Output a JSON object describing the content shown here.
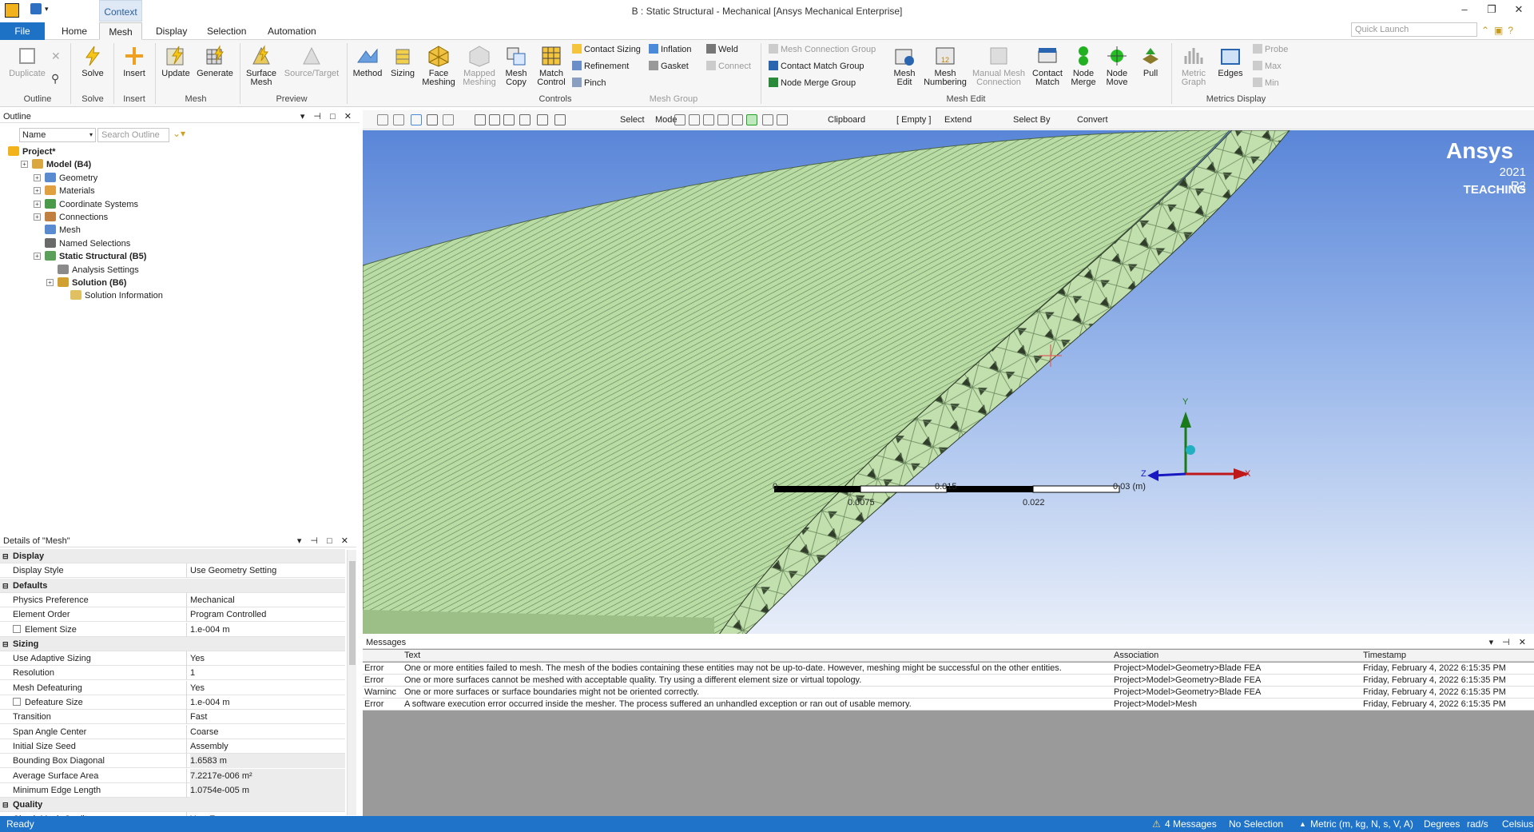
{
  "window": {
    "title": "B : Static Structural - Mechanical [Ansys Mechanical Enterprise]",
    "minimize": "–",
    "restore": "❐",
    "close": "✕",
    "quick_launch_placeholder": "Quick Launch"
  },
  "context_tab": "Context",
  "tabs": [
    "File",
    "Home",
    "Mesh",
    "Display",
    "Selection",
    "Automation"
  ],
  "active_tab": "Mesh",
  "ribbon": {
    "duplicate": "Duplicate",
    "solve": "Solve",
    "insert": "Insert",
    "update": "Update",
    "generate": "Generate",
    "surface_mesh": "Surface Mesh",
    "source_target": "Source/Target",
    "method": "Method",
    "sizing": "Sizing",
    "face_meshing": "Face Meshing",
    "mapped_meshing": "Mapped Meshing",
    "mesh_copy": "Mesh Copy",
    "match_control": "Match Control",
    "contact_sizing": "Contact Sizing",
    "refinement": "Refinement",
    "pinch": "Pinch",
    "inflation": "Inflation",
    "gasket": "Gasket",
    "weld": "Weld",
    "connect": "Connect",
    "mesh_connection_group": "Mesh Connection Group",
    "contact_match_group": "Contact Match Group",
    "node_merge_group": "Node Merge Group",
    "mesh_edit": "Mesh Edit",
    "mesh_numbering": "Mesh Numbering",
    "manual_mesh_connection": "Manual Mesh Connection",
    "contact_match": "Contact Match",
    "node_merge": "Node Merge",
    "node_move": "Node Move",
    "pull": "Pull",
    "metric_graph": "Metric Graph",
    "edges": "Edges",
    "probe": "Probe",
    "max": "Max",
    "min": "Min",
    "groups": {
      "outline": "Outline",
      "solve": "Solve",
      "insert": "Insert",
      "mesh": "Mesh",
      "preview": "Preview",
      "controls": "Controls",
      "mesh_group": "Mesh Group",
      "mesh_edit": "Mesh Edit",
      "metrics_display": "Metrics Display"
    }
  },
  "outline": {
    "title": "Outline",
    "name_filter": "Name",
    "search_placeholder": "Search Outline",
    "tree": [
      {
        "label": "Project*",
        "bold": true
      },
      {
        "label": "Model (B4)",
        "bold": true
      },
      {
        "label": "Geometry",
        "bold": false
      },
      {
        "label": "Materials",
        "bold": false
      },
      {
        "label": "Coordinate Systems",
        "bold": false
      },
      {
        "label": "Connections",
        "bold": false
      },
      {
        "label": "Mesh",
        "bold": false
      },
      {
        "label": "Named Selections",
        "bold": false
      },
      {
        "label": "Static Structural (B5)",
        "bold": true
      },
      {
        "label": "Analysis Settings",
        "bold": false
      },
      {
        "label": "Solution (B6)",
        "bold": true
      },
      {
        "label": "Solution Information",
        "bold": false
      }
    ]
  },
  "details": {
    "title": "Details of \"Mesh\"",
    "rows": [
      {
        "type": "section",
        "k": "Display"
      },
      {
        "k": "Display Style",
        "v": "Use Geometry Setting"
      },
      {
        "type": "section",
        "k": "Defaults"
      },
      {
        "k": "Physics Preference",
        "v": "Mechanical"
      },
      {
        "k": "Element Order",
        "v": "Program Controlled"
      },
      {
        "k": "Element Size",
        "v": "1.e-004 m",
        "check": true
      },
      {
        "type": "section",
        "k": "Sizing"
      },
      {
        "k": "Use Adaptive Sizing",
        "v": "Yes"
      },
      {
        "k": "Resolution",
        "v": "1"
      },
      {
        "k": "Mesh Defeaturing",
        "v": "Yes"
      },
      {
        "k": "Defeature Size",
        "v": "1.e-004 m",
        "check": true
      },
      {
        "k": "Transition",
        "v": "Fast"
      },
      {
        "k": "Span Angle Center",
        "v": "Coarse"
      },
      {
        "k": "Initial Size Seed",
        "v": "Assembly"
      },
      {
        "k": "Bounding Box Diagonal",
        "v": "1.6583 m",
        "ro": true
      },
      {
        "k": "Average Surface Area",
        "v": "7.2217e-006 m²",
        "ro": true
      },
      {
        "k": "Minimum Edge Length",
        "v": "1.0754e-005 m",
        "ro": true
      },
      {
        "type": "section",
        "k": "Quality"
      },
      {
        "k": "Check Mesh Quality",
        "v": "Yes, Errors"
      }
    ]
  },
  "graphics_toolbar": {
    "select": "Select",
    "mode": "Mode",
    "clipboard": "Clipboard",
    "empty": "[ Empty ]",
    "extend": "Extend",
    "select_by": "Select By",
    "convert": "Convert"
  },
  "viewport": {
    "brand": "Ansys",
    "version": "2021 R2",
    "edition": "TEACHING",
    "scale_labels_top": [
      "0",
      "0.015",
      "0.03 (m)"
    ],
    "scale_labels_bottom": [
      "0.0075",
      "0.022"
    ],
    "axes": {
      "x": "X",
      "y": "Y",
      "z": "Z"
    }
  },
  "messages": {
    "title": "Messages",
    "columns": [
      "Text",
      "Association",
      "Timestamp"
    ],
    "rows": [
      {
        "type": "Error",
        "text": "One or more entities failed to mesh. The mesh of the bodies containing these entities may not be up-to-date.  However, meshing might be successful on the other entities.",
        "assoc": "Project>Model>Geometry>Blade FEA",
        "time": "Friday, February 4, 2022 6:15:35 PM"
      },
      {
        "type": "Error",
        "text": "One or more surfaces cannot be meshed with acceptable quality. Try using a different element size or virtual topology.",
        "assoc": "Project>Model>Geometry>Blade FEA",
        "time": "Friday, February 4, 2022 6:15:35 PM"
      },
      {
        "type": "Warninc",
        "text": "One or more surfaces or surface boundaries might not be oriented correctly.",
        "assoc": "Project>Model>Geometry>Blade FEA",
        "time": "Friday, February 4, 2022 6:15:35 PM"
      },
      {
        "type": "Error",
        "text": "A software execution error occurred inside the mesher.  The process suffered an unhandled exception or ran out of usable memory.",
        "assoc": "Project>Model>Mesh",
        "time": "Friday, February 4, 2022 6:15:35 PM"
      }
    ]
  },
  "status": {
    "ready": "Ready",
    "messages": "4 Messages",
    "selection": "No Selection",
    "units": "Metric (m, kg, N, s, V, A)",
    "angle": "Degrees",
    "rate": "rad/s",
    "temp": "Celsius"
  },
  "colors": {
    "accent": "#1e72c6",
    "mesh_green": "#b9dca5",
    "viewport_top": "#5a86d8",
    "viewport_bottom": "#e8eef9"
  }
}
